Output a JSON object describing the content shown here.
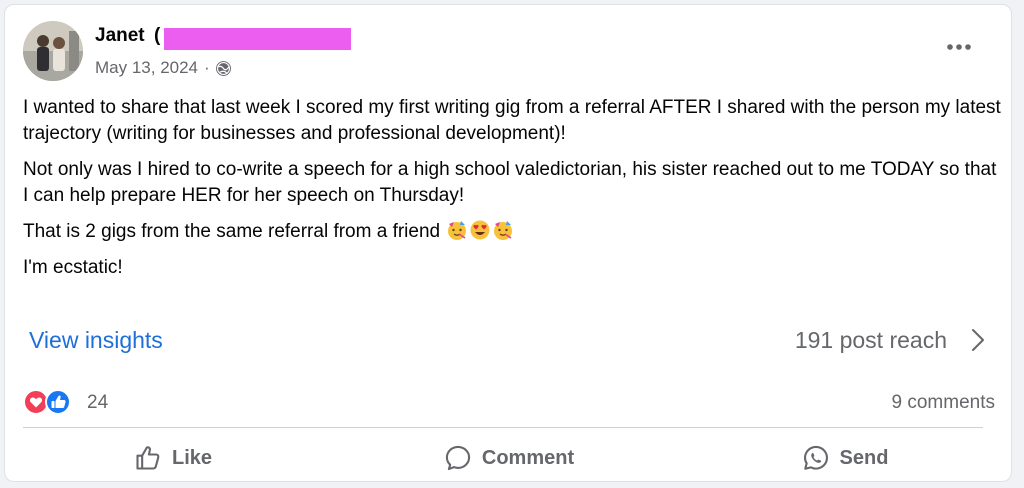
{
  "post": {
    "author": {
      "name": "Janet",
      "name_partial": "("
    },
    "date": "May 13, 2024",
    "separator": "·",
    "audience_icon": "globe-icon",
    "menu_icon": "more-horizontal-icon",
    "paragraphs": [
      "I wanted to share that last week I scored my first writing gig from a referral AFTER I shared with the person my latest trajectory (writing for businesses and professional development)!",
      "Not only was I hired to co-write a speech for a high school valedictorian, his sister reached out to me TODAY so that I can help prepare HER for her speech on Thursday!",
      "That is 2 gigs from the same referral from a friend",
      "I'm ecstatic!"
    ],
    "emojis": [
      "partying-face-emoji",
      "heart-eyes-emoji",
      "partying-face-emoji"
    ]
  },
  "insights": {
    "link_label": "View insights",
    "reach_label": "191 post reach"
  },
  "reactions": {
    "icons": [
      "love-reaction-icon",
      "like-reaction-icon"
    ],
    "count": "24",
    "comments": "9 comments"
  },
  "actions": {
    "like": "Like",
    "comment": "Comment",
    "send": "Send"
  },
  "colors": {
    "link_blue": "#1e6fd9",
    "secondary_text": "#65676b",
    "like_blue": "#1877f2",
    "love_red": "#f33e58",
    "redaction_pink": "#ec5ef0"
  }
}
